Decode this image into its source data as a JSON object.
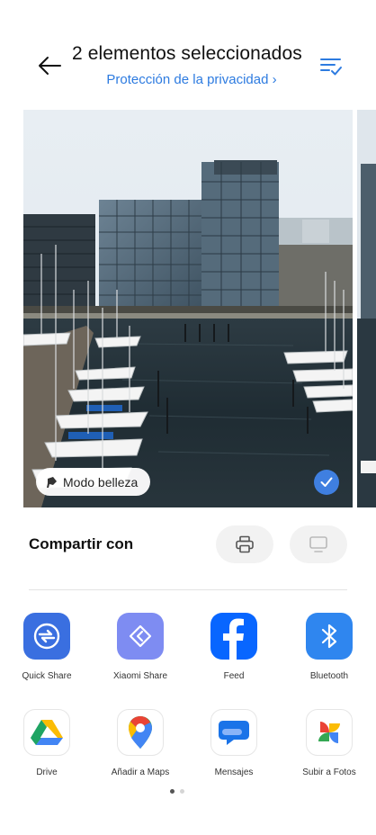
{
  "header": {
    "title": "2 elementos seleccionados",
    "privacy_link": "Protección de la privacidad",
    "privacy_chevron": "›"
  },
  "preview": {
    "beauty_badge": "Modo belleza",
    "selected": true
  },
  "share": {
    "title": "Compartir con",
    "print_icon": "printer-icon",
    "screen_icon": "monitor-icon"
  },
  "apps_row1": [
    {
      "label": "Quick Share",
      "icon": "quick-share-icon",
      "color": "#3a6fe0"
    },
    {
      "label": "Xiaomi Share",
      "icon": "xiaomi-share-icon",
      "color": "#7e8cf2"
    },
    {
      "label": "Feed",
      "icon": "facebook-icon",
      "color": "#0866ff"
    },
    {
      "label": "Bluetooth",
      "icon": "bluetooth-icon",
      "color": "#2f86ef"
    }
  ],
  "apps_row2": [
    {
      "label": "Drive",
      "icon": "google-drive-icon"
    },
    {
      "label": "Añadir a Maps",
      "icon": "google-maps-icon"
    },
    {
      "label": "Mensajes",
      "icon": "messages-icon"
    },
    {
      "label": "Subir a Fotos",
      "icon": "google-photos-icon"
    }
  ],
  "pager": {
    "pages": 2,
    "active": 0
  }
}
